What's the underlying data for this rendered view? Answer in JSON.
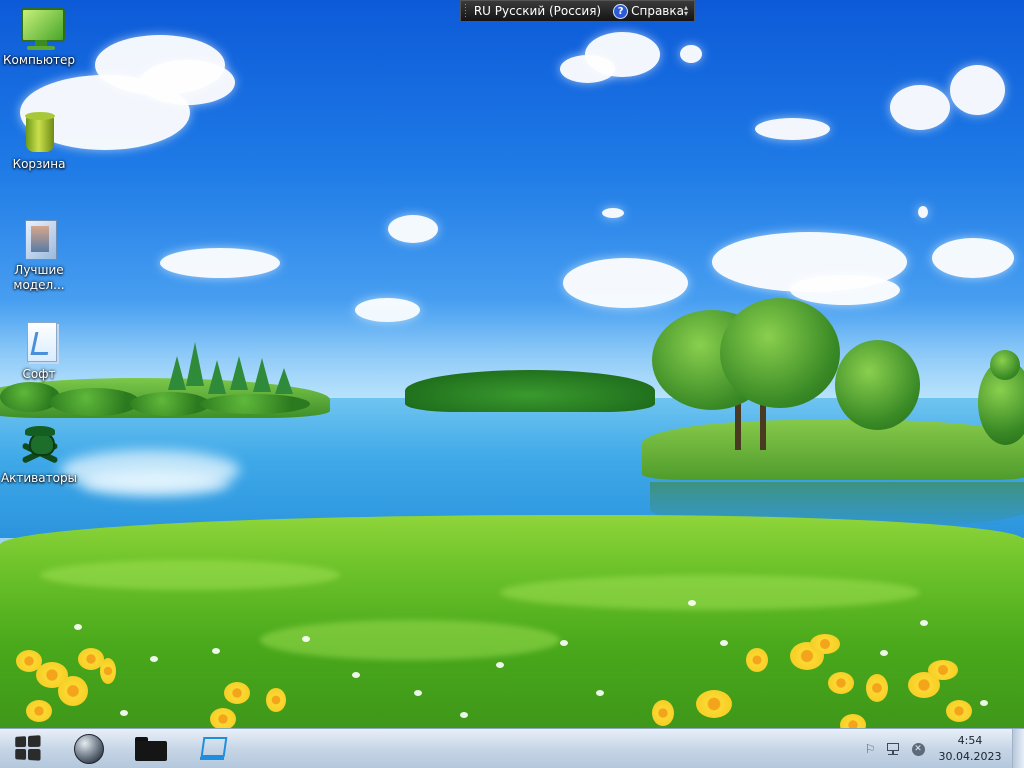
{
  "language_bar": {
    "language": "RU Русский (Россия)",
    "help_label": "Справка"
  },
  "desktop_icons": [
    {
      "label": "Компьютер",
      "icon": "computer-icon"
    },
    {
      "label": "Корзина",
      "icon": "recycle-bin-icon"
    },
    {
      "label": "Лучшие модел...",
      "icon": "document-icon"
    },
    {
      "label": "Софт",
      "icon": "folder-document-icon"
    },
    {
      "label": "Активаторы",
      "icon": "pirate-icon"
    }
  ],
  "taskbar": {
    "pinned": [
      {
        "name": "start-button",
        "icon": "windows-logo-icon"
      },
      {
        "name": "browser",
        "icon": "globe-icon"
      },
      {
        "name": "file-explorer",
        "icon": "folder-icon"
      },
      {
        "name": "computer",
        "icon": "monitor-icon"
      }
    ],
    "tray_icons": [
      "flag-icon",
      "network-icon",
      "volume-muted-icon"
    ],
    "clock": {
      "time": "4:54",
      "date": "30.04.2023"
    }
  }
}
